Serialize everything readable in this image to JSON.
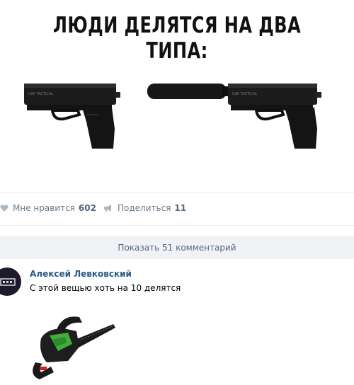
{
  "meme": {
    "title": "ЛЮДИ ДЕЛЯТСЯ НА ДВА ТИПА:",
    "left_image": "pistol-icon",
    "right_image": "pistol-with-silencer-icon"
  },
  "actions": {
    "like_label": "Мне нравится",
    "like_count": "602",
    "share_label": "Поделиться",
    "share_count": "11"
  },
  "comments": {
    "show_label": "Показать 51 комментарий",
    "items": [
      {
        "author": "Алексей Левковский",
        "text": "С этой вещью хоть на 10 делятся",
        "attachment": "chainsaw-icon"
      }
    ]
  },
  "colors": {
    "link": "#2a5885",
    "muted": "#6b7b8c",
    "bar": "#f0f2f5"
  }
}
